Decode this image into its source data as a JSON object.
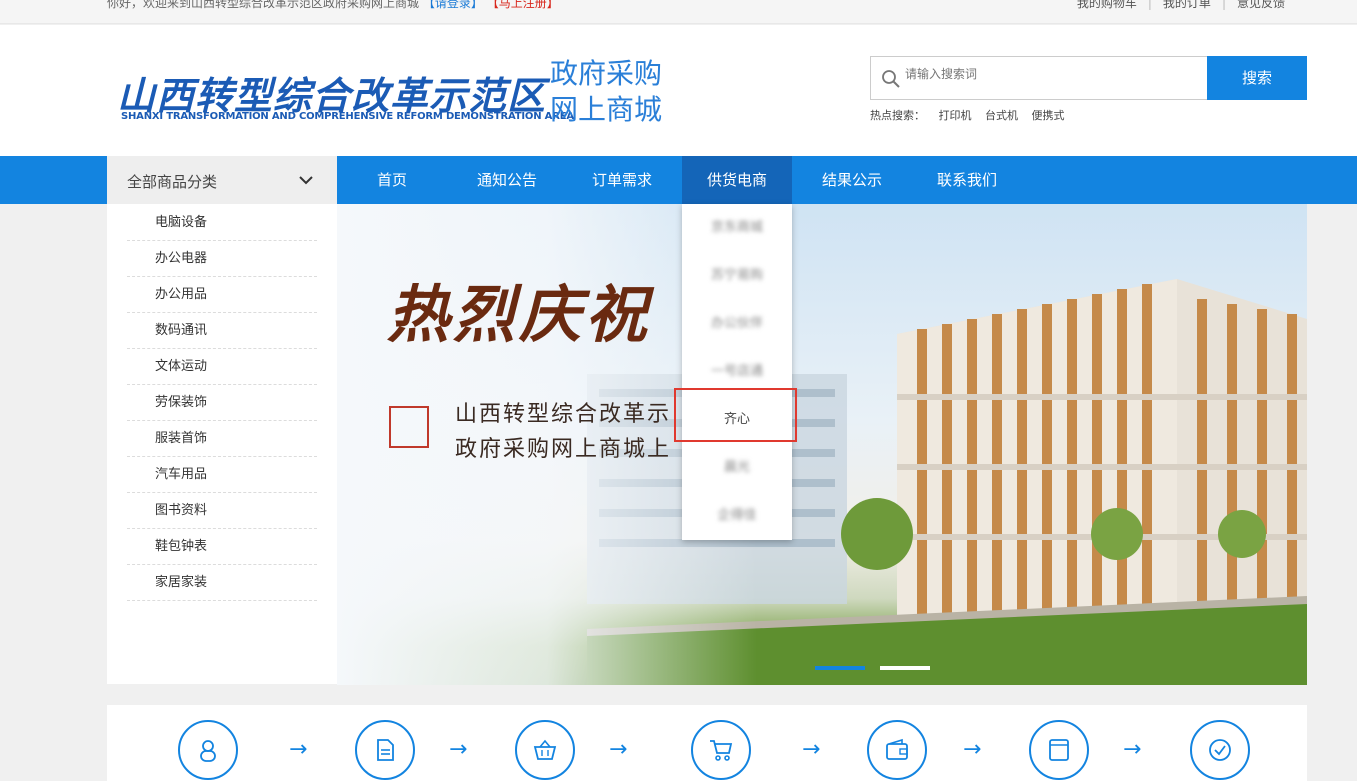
{
  "topbar": {
    "welcome": "你好，欢迎来到山西转型综合改革示范区政府采购网上商城",
    "login": "【请登录】",
    "register": "【马上注册】",
    "links": [
      "我的购物车",
      "我的订单",
      "意见反馈"
    ]
  },
  "header": {
    "logo_cn": "山西转型综合改革示范区",
    "logo_en": "SHANXI TRANSFORMATION AND COMPREHENSIVE REFORM DEMONSTRATION AREA",
    "sub_line1": "政府采购",
    "sub_line2": "网上商城",
    "search_placeholder": "请输入搜索词",
    "search_button": "搜索",
    "hot_label": "热点搜索：",
    "hot_items": [
      "打印机",
      "台式机",
      "便携式"
    ]
  },
  "nav": {
    "category_label": "全部商品分类",
    "items": [
      "首页",
      "通知公告",
      "订单需求",
      "供货电商",
      "结果公示",
      "联系我们"
    ],
    "active_index": 3
  },
  "categories": [
    "电脑设备",
    "办公电器",
    "办公用品",
    "数码通讯",
    "文体运动",
    "劳保装饰",
    "服装首饰",
    "汽车用品",
    "图书资料",
    "鞋包钟表",
    "家居家装"
  ],
  "dropdown": {
    "items": [
      "京东商城",
      "苏宁易购",
      "办公伙伴",
      "一号店通",
      "齐心",
      "晨光",
      "企得佳"
    ],
    "highlighted_index": 4
  },
  "banner": {
    "title": "热烈庆祝",
    "line1": "山西转型综合改革示",
    "line2": "政府采购网上商城上"
  },
  "colors": {
    "primary": "#1384e0",
    "nav_active": "#1465b8",
    "highlight_border": "#e0392f"
  },
  "flow_icons": [
    "user-icon",
    "document-icon",
    "basket-icon",
    "cart-icon",
    "wallet-icon",
    "box-icon",
    "check-icon"
  ]
}
